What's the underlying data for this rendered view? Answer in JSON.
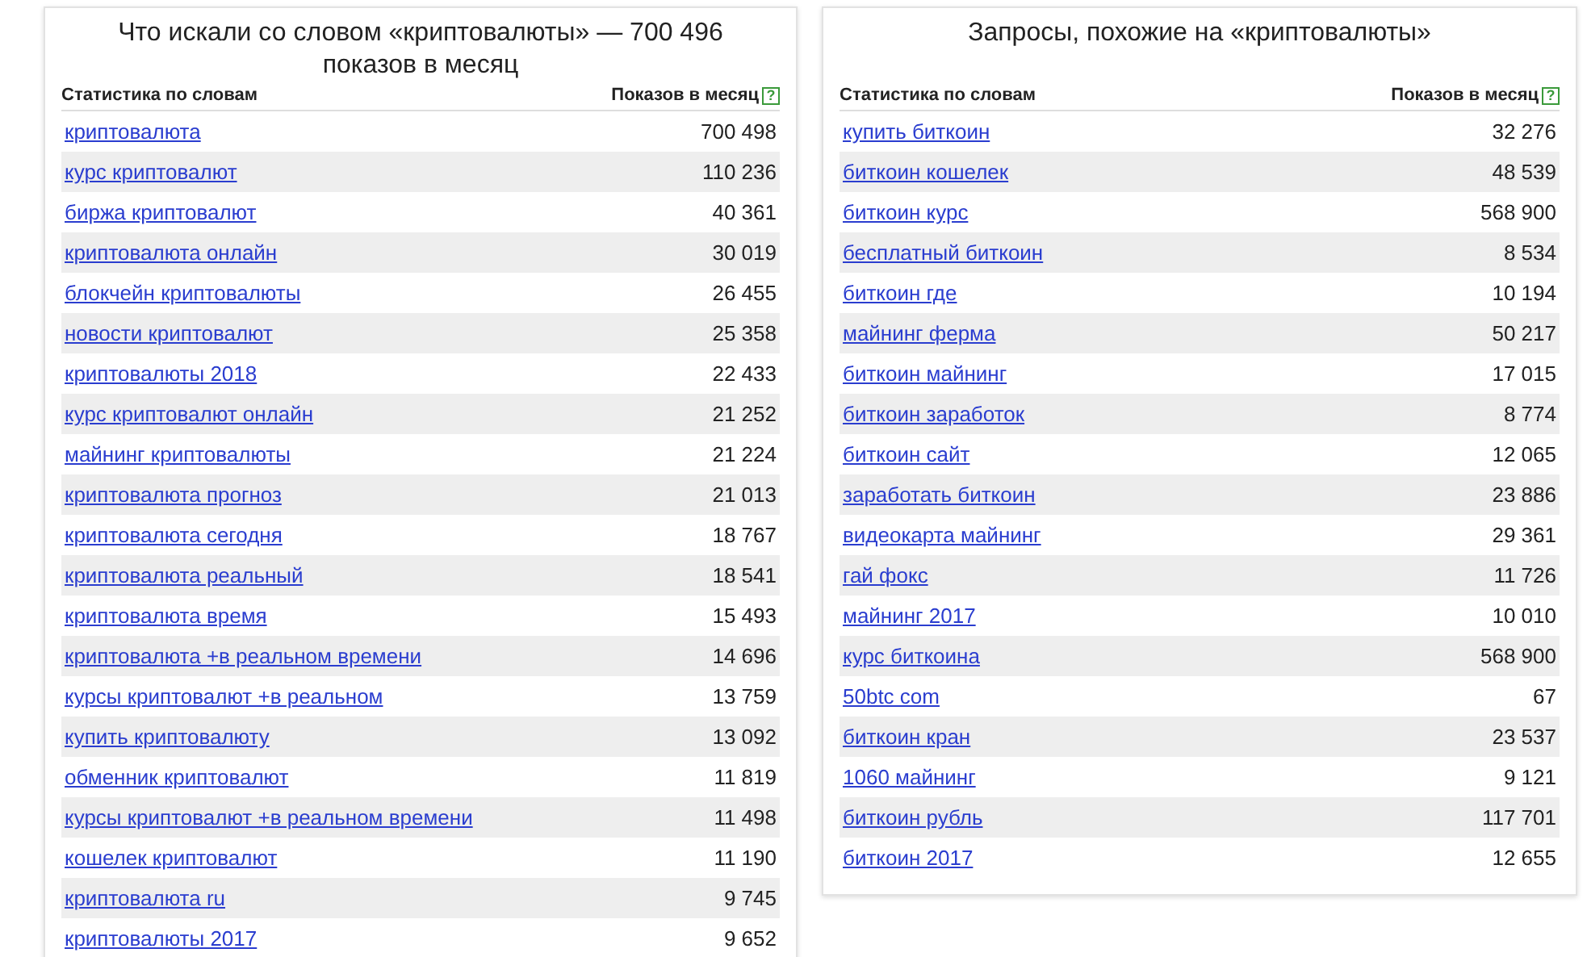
{
  "panels": [
    {
      "title": "Что искали со словом «криптовалюты» — 700 496 показов в месяц",
      "columns": [
        "Статистика по словам",
        "Показов в месяц"
      ],
      "help_icon": "?",
      "rows": [
        {
          "phrase": "криптовалюта",
          "count": "700 498"
        },
        {
          "phrase": "курс криптовалют",
          "count": "110 236"
        },
        {
          "phrase": "биржа криптовалют",
          "count": "40 361"
        },
        {
          "phrase": "криптовалюта онлайн",
          "count": "30 019"
        },
        {
          "phrase": "блокчейн криптовалюты",
          "count": "26 455"
        },
        {
          "phrase": "новости криптовалют",
          "count": "25 358"
        },
        {
          "phrase": "криптовалюты 2018",
          "count": "22 433"
        },
        {
          "phrase": "курс криптовалют онлайн",
          "count": "21 252"
        },
        {
          "phrase": "майнинг криптовалюты",
          "count": "21 224"
        },
        {
          "phrase": "криптовалюта прогноз",
          "count": "21 013"
        },
        {
          "phrase": "криптовалюта сегодня",
          "count": "18 767"
        },
        {
          "phrase": "криптовалюта реальный",
          "count": "18 541"
        },
        {
          "phrase": "криптовалюта время",
          "count": "15 493"
        },
        {
          "phrase": "криптовалюта +в реальном времени",
          "count": "14 696"
        },
        {
          "phrase": "курсы криптовалют +в реальном",
          "count": "13 759"
        },
        {
          "phrase": "купить криптовалюту",
          "count": "13 092"
        },
        {
          "phrase": "обменник криптовалют",
          "count": "11 819"
        },
        {
          "phrase": "курсы криптовалют +в реальном времени",
          "count": "11 498"
        },
        {
          "phrase": "кошелек криптовалют",
          "count": "11 190"
        },
        {
          "phrase": "криптовалюта ru",
          "count": "9 745"
        },
        {
          "phrase": "криптовалюты 2017",
          "count": "9 652"
        }
      ]
    },
    {
      "title": "Запросы, похожие на «криптовалюты»",
      "columns": [
        "Статистика по словам",
        "Показов в месяц"
      ],
      "help_icon": "?",
      "rows": [
        {
          "phrase": "купить биткоин",
          "count": "32 276"
        },
        {
          "phrase": "биткоин кошелек",
          "count": "48 539"
        },
        {
          "phrase": "биткоин курс",
          "count": "568 900"
        },
        {
          "phrase": "бесплатный биткоин",
          "count": "8 534"
        },
        {
          "phrase": "биткоин где",
          "count": "10 194"
        },
        {
          "phrase": "майнинг ферма",
          "count": "50 217"
        },
        {
          "phrase": "биткоин майнинг",
          "count": "17 015"
        },
        {
          "phrase": "биткоин заработок",
          "count": "8 774"
        },
        {
          "phrase": "биткоин сайт",
          "count": "12 065"
        },
        {
          "phrase": "заработать биткоин",
          "count": "23 886"
        },
        {
          "phrase": "видеокарта майнинг",
          "count": "29 361"
        },
        {
          "phrase": "гай фокс",
          "count": "11 726"
        },
        {
          "phrase": "майнинг 2017",
          "count": "10 010"
        },
        {
          "phrase": "курс биткоина",
          "count": "568 900"
        },
        {
          "phrase": "50btc com",
          "count": "67"
        },
        {
          "phrase": "биткоин кран",
          "count": "23 537"
        },
        {
          "phrase": "1060 майнинг",
          "count": "9 121"
        },
        {
          "phrase": "биткоин рубль",
          "count": "117 701"
        },
        {
          "phrase": "биткоин 2017",
          "count": "12 655"
        }
      ]
    }
  ]
}
